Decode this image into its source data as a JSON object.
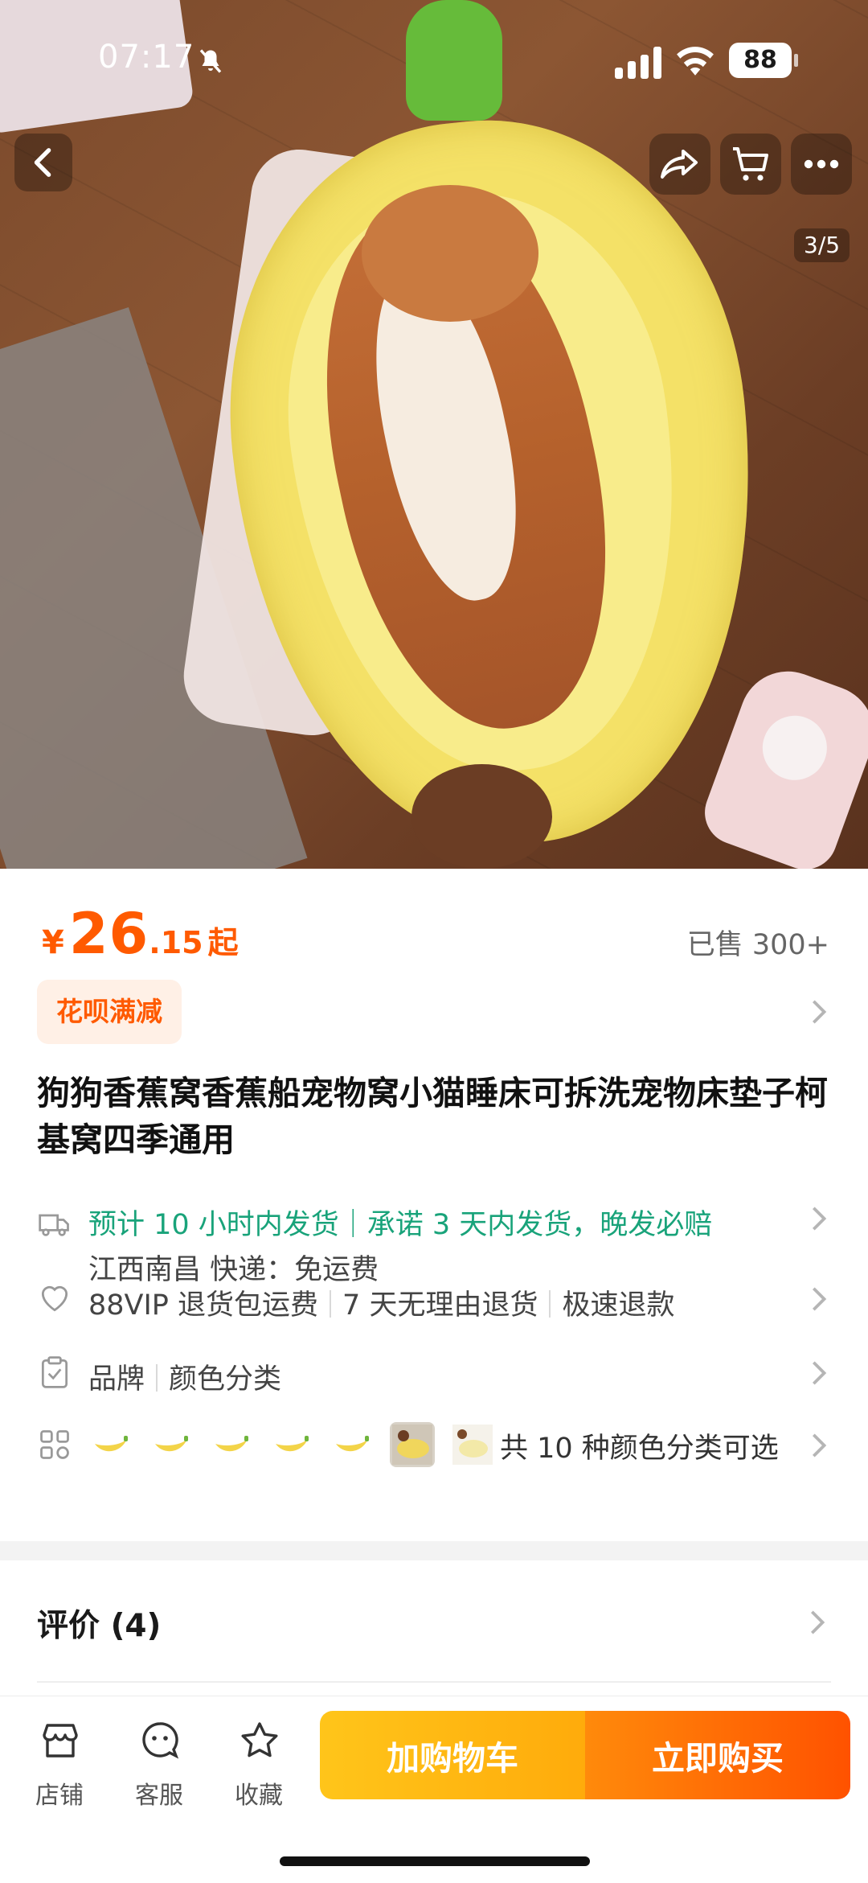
{
  "status_bar": {
    "time": "07:17",
    "battery": "88"
  },
  "gallery": {
    "counter": "3/5"
  },
  "price": {
    "currency": "¥",
    "integer": "26",
    "decimal": ".15",
    "suffix": "起"
  },
  "sold": "已售 300+",
  "promo": {
    "tag": "花呗满减"
  },
  "product": {
    "title": "狗狗香蕉窝香蕉船宠物窝小猫睡床可拆洗宠物床垫子柯基窝四季通用"
  },
  "shipping": {
    "line1": "预计 10 小时内发货｜承诺 3 天内发货，晚发必赔",
    "line2": "江西南昌  快递：免运费"
  },
  "services": [
    "88VIP 退货包运费",
    "7 天无理由退货",
    "极速退款"
  ],
  "params": [
    "品牌",
    "颜色分类"
  ],
  "variants": {
    "label": "共 10 种颜色分类可选",
    "swatch_icons": [
      "banana-icon",
      "banana-icon",
      "banana-icon",
      "banana-icon",
      "banana-icon",
      "photo-thumb",
      "photo-thumb"
    ]
  },
  "reviews": {
    "label": "评价 (4)"
  },
  "bottom_bar": {
    "store": "店铺",
    "service": "客服",
    "favorite": "收藏",
    "add_to_cart": "加购物车",
    "buy_now": "立即购买"
  },
  "colors": {
    "accent": "#ff5a00",
    "ship_green": "#19a37a",
    "cart_yellow": "#ffb90f",
    "buy_orange": "#ff5a00"
  }
}
